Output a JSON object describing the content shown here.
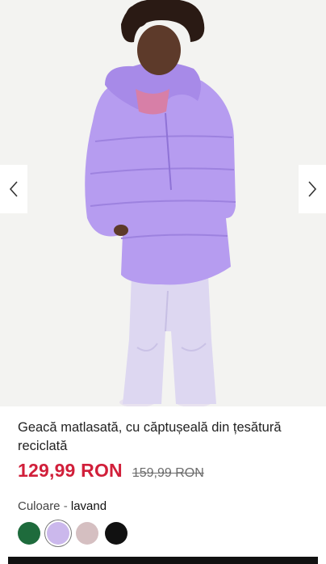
{
  "product": {
    "title": "Geacă matlasată, cu căptușeală din țesătură reciclată",
    "price_current": "129,99 RON",
    "price_old": "159,99 RON",
    "color_label": "Culoare",
    "color_separator": " - ",
    "color_value": "lavand"
  },
  "swatches": [
    {
      "name": "green",
      "color": "#1e6b3c"
    },
    {
      "name": "lavender",
      "color": "#cbb8ec",
      "selected": true
    },
    {
      "name": "dusty-pink",
      "color": "#d5bfc1"
    },
    {
      "name": "black",
      "color": "#111111"
    }
  ],
  "icons": {
    "prev": "chevron-left-icon",
    "next": "chevron-right-icon"
  },
  "colors": {
    "price": "#d11f3a",
    "jacket": "#b69cf0",
    "pants": "#dcd6f0"
  }
}
